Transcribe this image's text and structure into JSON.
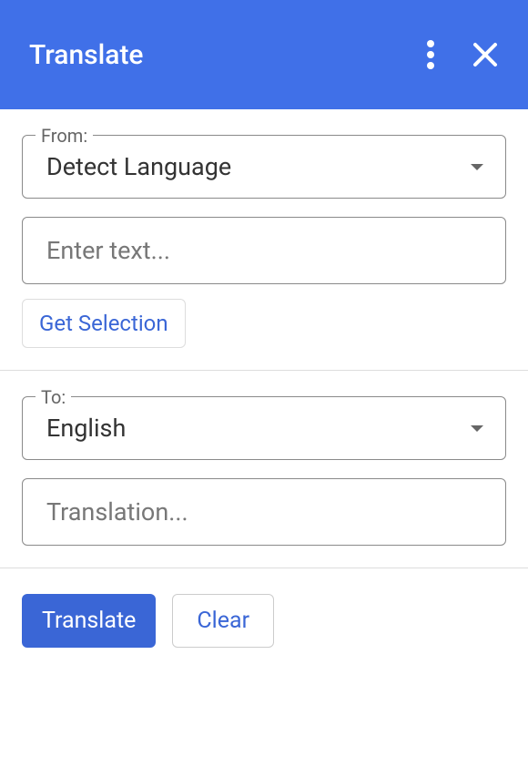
{
  "header": {
    "title": "Translate"
  },
  "from": {
    "label": "From:",
    "value": "Detect Language"
  },
  "input": {
    "placeholder": "Enter text..."
  },
  "get_selection_label": "Get Selection",
  "to": {
    "label": "To:",
    "value": "English"
  },
  "output": {
    "placeholder": "Translation..."
  },
  "actions": {
    "translate": "Translate",
    "clear": "Clear"
  }
}
